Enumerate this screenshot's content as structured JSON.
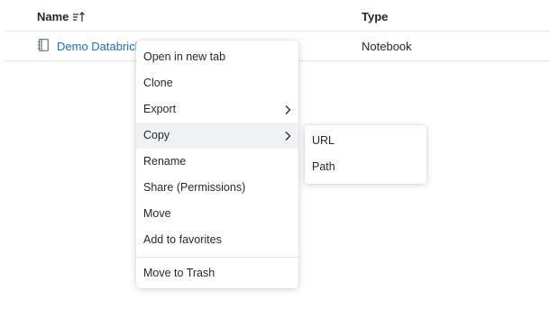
{
  "table": {
    "columns": {
      "name": "Name",
      "type": "Type"
    },
    "rows": [
      {
        "name": "Demo Databricks",
        "type": "Notebook",
        "icon": "notebook-icon"
      }
    ]
  },
  "context_menu": {
    "items": [
      {
        "label": "Open in new tab"
      },
      {
        "label": "Clone"
      },
      {
        "label": "Export",
        "submenu": true
      },
      {
        "label": "Copy",
        "submenu": true,
        "active": true
      },
      {
        "label": "Rename"
      },
      {
        "label": "Share (Permissions)"
      },
      {
        "label": "Move"
      },
      {
        "label": "Add to favorites"
      },
      {
        "label": "Move to Trash"
      }
    ]
  },
  "copy_submenu": {
    "items": [
      {
        "label": "URL"
      },
      {
        "label": "Path"
      }
    ]
  },
  "colors": {
    "link": "#2272b4",
    "text": "#1f272d",
    "hover": "#f0f1f2",
    "border": "#e3e6e8"
  }
}
